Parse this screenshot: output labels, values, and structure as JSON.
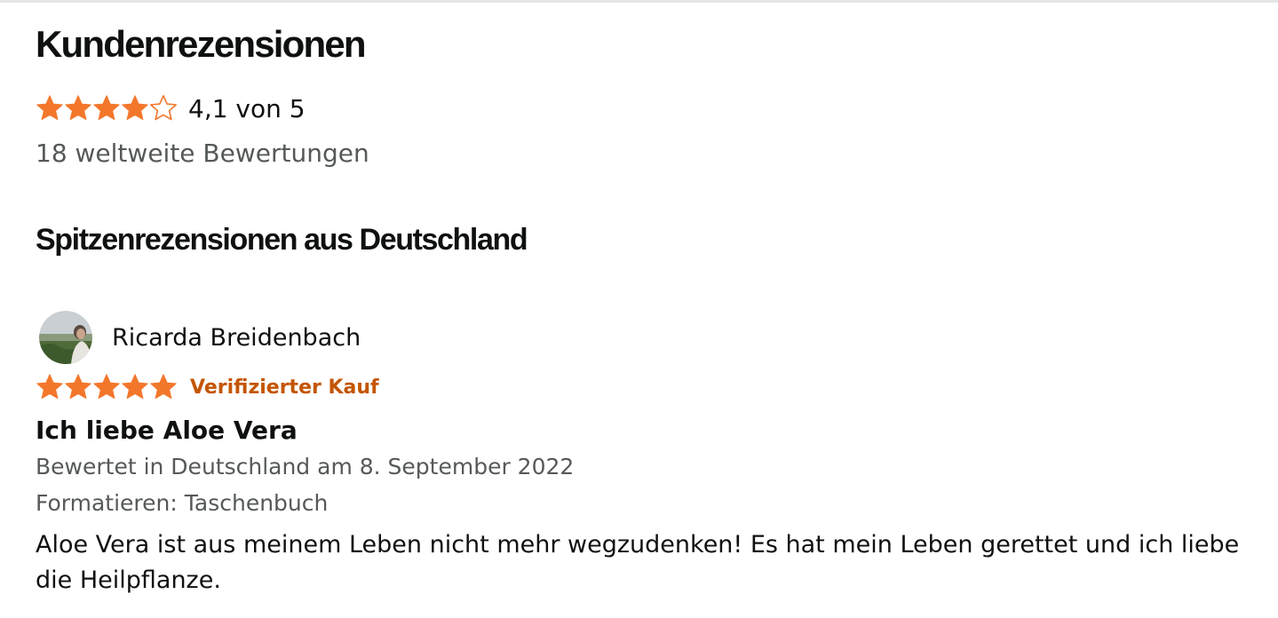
{
  "summary": {
    "heading": "Kundenrezensionen",
    "average_rating": 4.1,
    "max_rating": 5,
    "rating_text": "4,1 von 5",
    "total_ratings_text": "18 weltweite Bewertungen",
    "star_color": "#f3772b"
  },
  "top_reviews": {
    "heading": "Spitzenrezensionen aus Deutschland",
    "reviews": [
      {
        "reviewer_name": "Ricarda Breidenbach",
        "rating": 5,
        "verified_label": "Verifizierter Kauf",
        "title": "Ich liebe Aloe Vera",
        "date_text": "Bewertet in Deutschland am 8. September 2022",
        "format_text": "Formatieren: Taschenbuch",
        "body": "Aloe Vera ist aus meinem Leben nicht mehr wegzudenken! Es hat mein Leben gerettet und ich liebe die Heilpflanze."
      }
    ]
  },
  "colors": {
    "text_primary": "#0f1111",
    "text_secondary": "#565959",
    "verified": "#c45500",
    "star": "#f3772b"
  }
}
